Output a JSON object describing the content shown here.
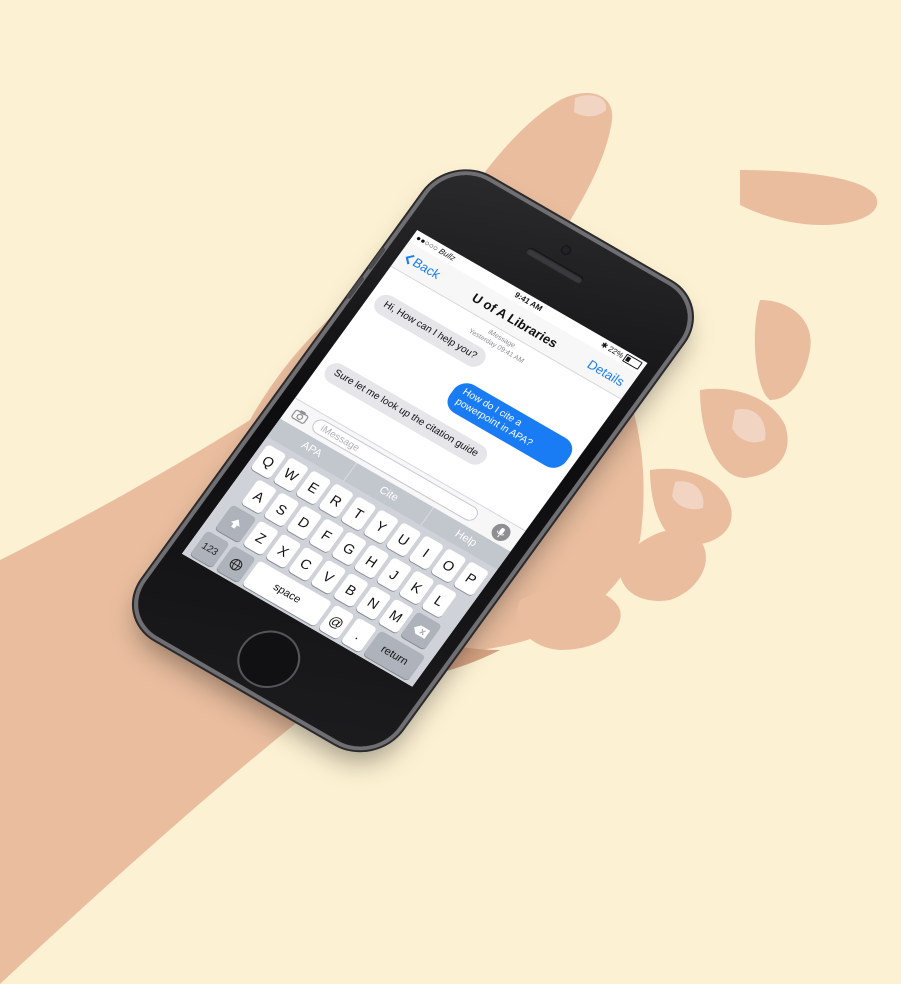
{
  "colors": {
    "background": "#fdf1d3",
    "accent_blue": "#1a7cf5",
    "incoming_bubble": "#e5e5ea",
    "skin": "#e9bd9e"
  },
  "status_bar": {
    "carrier": "●●○○○ Bullz",
    "time": "9:41 AM",
    "battery": "22%",
    "battery_level": 0.22
  },
  "nav": {
    "back_label": "Back",
    "title": "U of A Libraries",
    "details_label": "Details"
  },
  "thread": {
    "service": "iMessage",
    "timestamp": "Yesterday 09:41 AM",
    "messages": [
      {
        "direction": "in",
        "text": "Hi, How can I help you?"
      },
      {
        "direction": "out",
        "text": "How do I cite a powerpoint in APA?"
      },
      {
        "direction": "in",
        "text": "Sure let me look up the citation guide"
      }
    ]
  },
  "compose": {
    "placeholder": "iMessage",
    "camera_icon": "camera-icon",
    "mic_icon": "microphone-icon"
  },
  "keyboard": {
    "suggestions": [
      "APA",
      "Cite",
      "Help"
    ],
    "row1": [
      "Q",
      "W",
      "E",
      "R",
      "T",
      "Y",
      "U",
      "I",
      "O",
      "P"
    ],
    "row2": [
      "A",
      "S",
      "D",
      "F",
      "G",
      "H",
      "J",
      "K",
      "L"
    ],
    "row3": [
      "Z",
      "X",
      "C",
      "V",
      "B",
      "N",
      "M"
    ],
    "numbers_label": "123",
    "space_label": "space",
    "at_label": "@",
    "period_label": ".",
    "return_label": "return",
    "shift_icon": "shift-arrow-icon",
    "delete_icon": "backspace-icon",
    "globe_icon": "globe-icon"
  }
}
